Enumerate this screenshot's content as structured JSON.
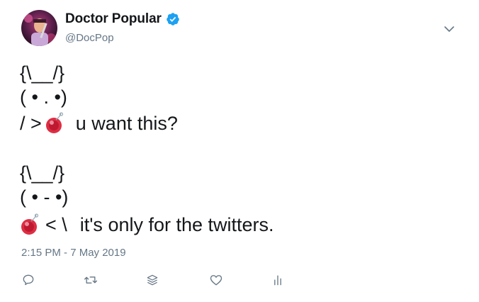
{
  "author": {
    "display_name": "Doctor Popular",
    "handle": "@DocPop",
    "verified": true,
    "verified_color": "#1da1f2"
  },
  "tweet": {
    "lines": [
      "{\\__/}",
      "( • . •)",
      "/ >",
      "u want this?",
      "{\\__/}",
      "( • - •)",
      "< \\",
      "it's only for the twitters."
    ],
    "emoji": "yo-yo",
    "timestamp": "2:15 PM - 7 May 2019"
  },
  "actions": [
    {
      "name": "reply",
      "icon": "reply-icon"
    },
    {
      "name": "retweet",
      "icon": "retweet-icon"
    },
    {
      "name": "stack",
      "icon": "stack-icon"
    },
    {
      "name": "like",
      "icon": "heart-icon"
    },
    {
      "name": "analytics",
      "icon": "analytics-icon"
    }
  ],
  "colors": {
    "text": "#14171a",
    "secondary": "#657786",
    "icon": "#657786",
    "yoyo_red": "#dd2e44"
  }
}
